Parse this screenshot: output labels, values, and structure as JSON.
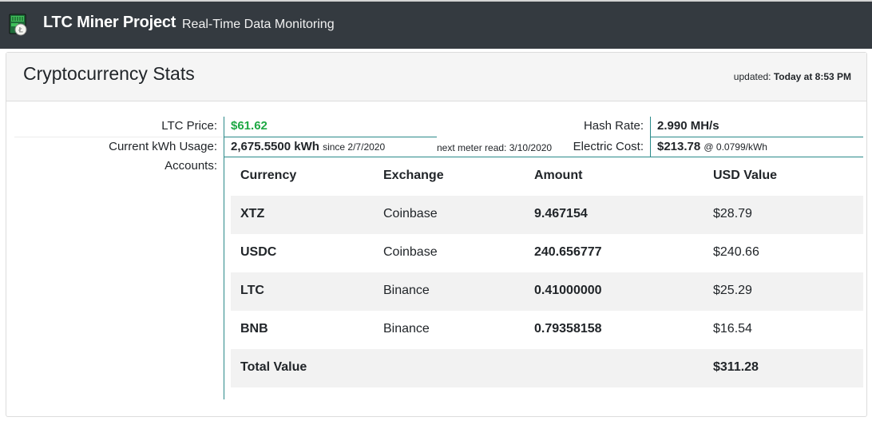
{
  "header": {
    "brand": "LTC Miner Project",
    "tagline": "Real-Time Data Monitoring",
    "logo_icon": "ltc-miner-logo-icon"
  },
  "card": {
    "title": "Cryptocurrency Stats",
    "updated_label": "updated:",
    "updated_value": "Today at 8:53 PM"
  },
  "stats": {
    "ltc_price_label": "LTC Price:",
    "ltc_price_value": "$61.62",
    "kwh_label": "Current kWh Usage:",
    "kwh_value": "2,675.5500 kWh",
    "kwh_since": "since 2/7/2020",
    "next_meter": "next meter read: 3/10/2020",
    "hash_label": "Hash Rate:",
    "hash_value": "2.990 MH/s",
    "electric_label": "Electric Cost:",
    "electric_value": "$213.78",
    "electric_rate": "@ 0.0799/kWh",
    "accounts_label": "Accounts:"
  },
  "accounts": {
    "headers": [
      "Currency",
      "Exchange",
      "Amount",
      "USD Value"
    ],
    "rows": [
      {
        "currency": "XTZ",
        "exchange": "Coinbase",
        "amount": "9.467154",
        "usd": "$28.79"
      },
      {
        "currency": "USDC",
        "exchange": "Coinbase",
        "amount": "240.656777",
        "usd": "$240.66"
      },
      {
        "currency": "LTC",
        "exchange": "Binance",
        "amount": "0.41000000",
        "usd": "$25.29"
      },
      {
        "currency": "BNB",
        "exchange": "Binance",
        "amount": "0.79358158",
        "usd": "$16.54"
      }
    ],
    "total_label": "Total Value",
    "total_value": "$311.28"
  },
  "colors": {
    "navbar": "#343a40",
    "accent_line": "#2a8a8a",
    "price_green": "#1ea844",
    "row_shade": "#f2f2f2"
  }
}
